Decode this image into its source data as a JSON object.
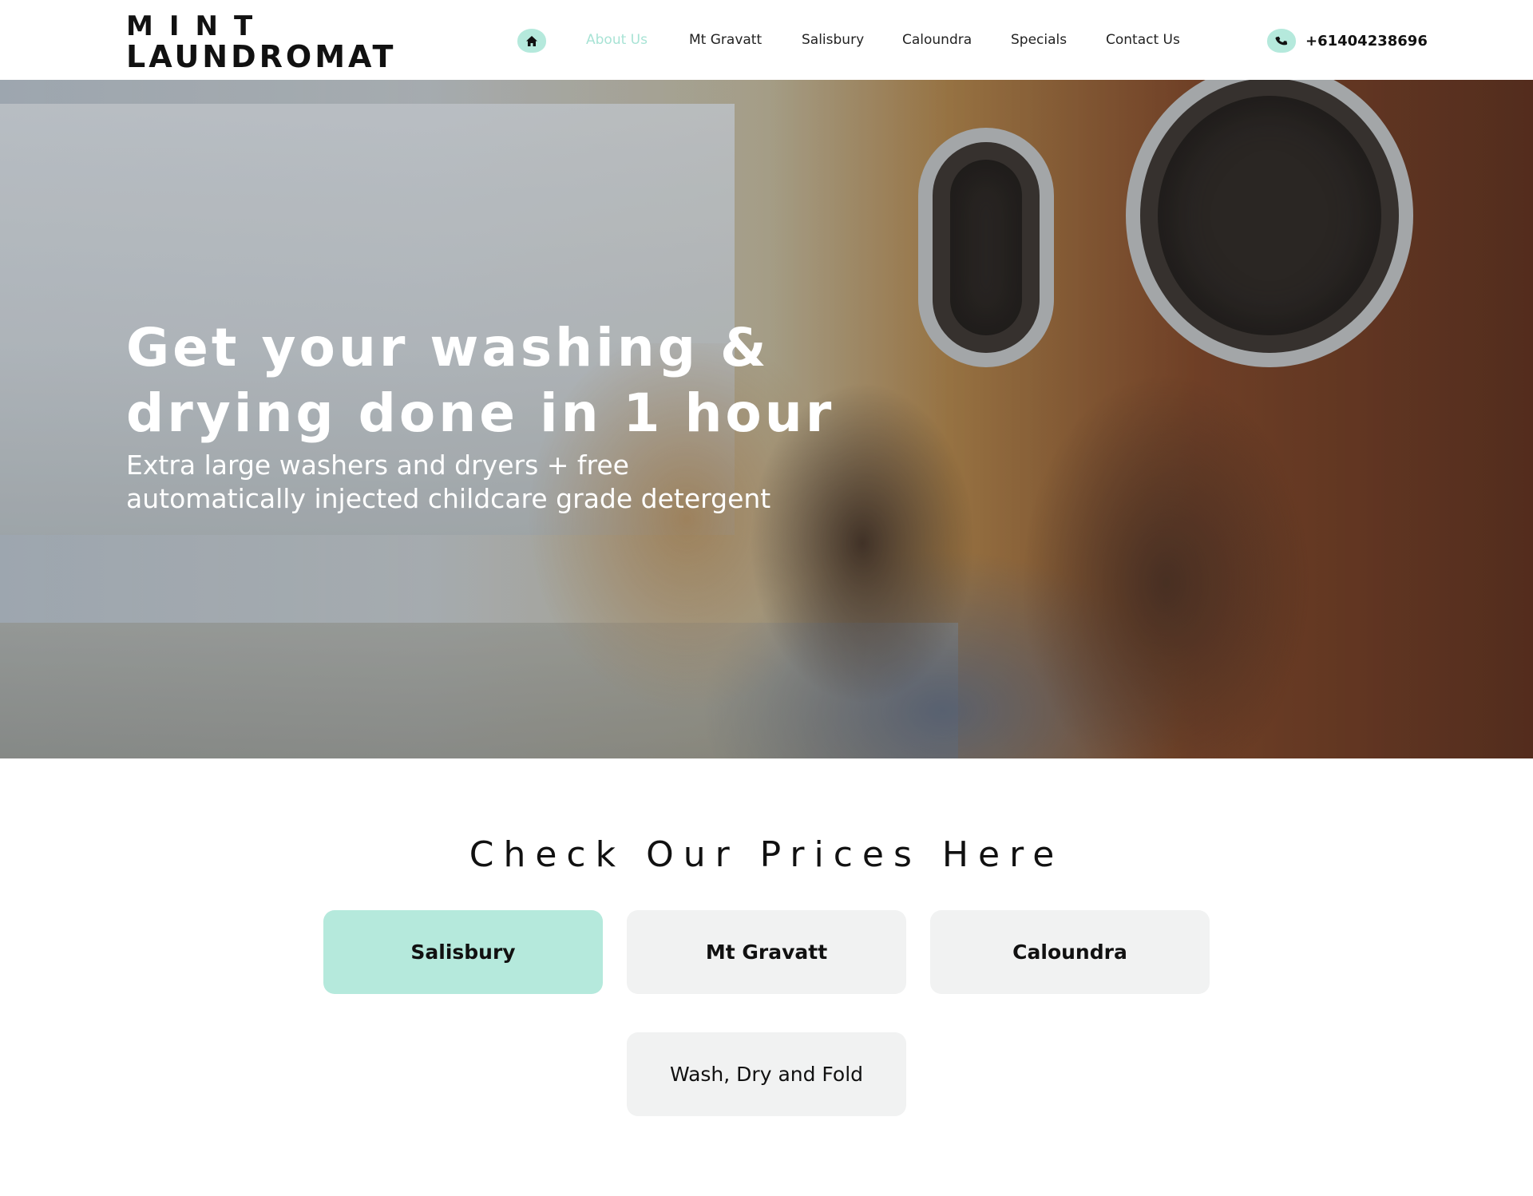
{
  "header": {
    "logo_line1": "MINT",
    "logo_line2": "LAUNDROMAT",
    "nav_items": [
      {
        "label": "About Us",
        "active": true
      },
      {
        "label": "Mt Gravatt",
        "active": false
      },
      {
        "label": "Salisbury",
        "active": false
      },
      {
        "label": "Caloundra",
        "active": false
      },
      {
        "label": "Specials",
        "active": false
      },
      {
        "label": "Contact Us",
        "active": false
      }
    ],
    "home_icon": "home-icon",
    "phone_icon": "phone-icon",
    "phone_number": "+61404238696"
  },
  "hero": {
    "title": "Get your washing & drying done in 1 hour",
    "subtitle": "Extra large washers and dryers + free automatically injected childcare grade detergent"
  },
  "prices": {
    "title": "Check Our Prices Here",
    "buttons": [
      {
        "label": "Salisbury",
        "active": true
      },
      {
        "label": "Mt Gravatt",
        "active": false
      },
      {
        "label": "Caloundra",
        "active": false
      },
      {
        "label": "Wash, Dry and Fold",
        "active": false
      }
    ]
  },
  "colors": {
    "accent": "#b5e9dc",
    "active_nav": "#a8e3d5",
    "button_bg": "#f1f2f2",
    "text": "#111111"
  }
}
